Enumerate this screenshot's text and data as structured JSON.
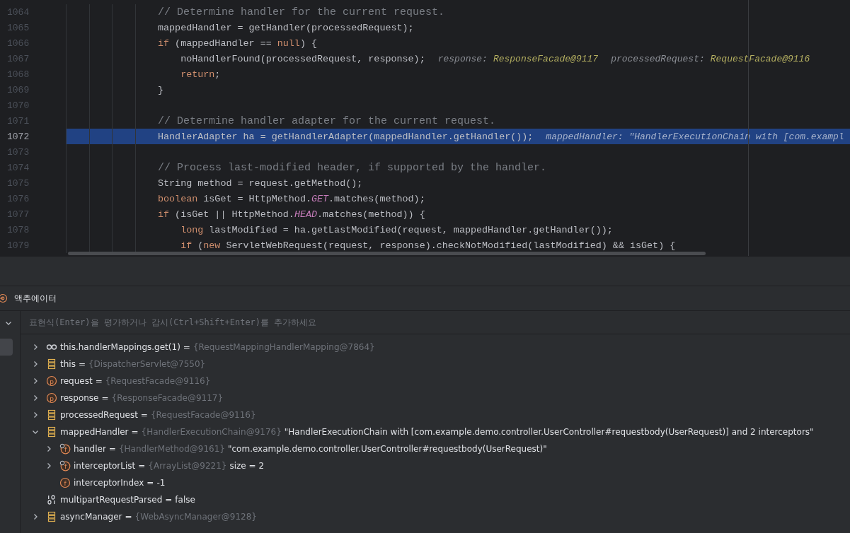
{
  "editor": {
    "lines": [
      {
        "number": "1064",
        "current": false,
        "segments": [
          {
            "kind": "comment",
            "text": "// Determine handler for the current request."
          }
        ]
      },
      {
        "number": "1065",
        "current": false,
        "segments": [
          {
            "kind": "plain",
            "text": "mappedHandler = getHandler(processedRequest);"
          }
        ]
      },
      {
        "number": "1066",
        "current": false,
        "segments": [
          {
            "kind": "keyword",
            "text": "if"
          },
          {
            "kind": "plain",
            "text": " (mappedHandler == "
          },
          {
            "kind": "keyword",
            "text": "null"
          },
          {
            "kind": "plain",
            "text": ") {"
          }
        ]
      },
      {
        "number": "1067",
        "current": false,
        "segments": [
          {
            "kind": "plain",
            "text": "    noHandlerFound(processedRequest, response);"
          },
          {
            "kind": "hint-label",
            "text": "response:"
          },
          {
            "kind": "hint-value",
            "text": "ResponseFacade@9117"
          },
          {
            "kind": "hint-label",
            "text": "processedRequest:"
          },
          {
            "kind": "hint-value",
            "text": "RequestFacade@9116"
          }
        ]
      },
      {
        "number": "1068",
        "current": false,
        "segments": [
          {
            "kind": "keyword",
            "text": "    return"
          },
          {
            "kind": "plain",
            "text": ";"
          }
        ]
      },
      {
        "number": "1069",
        "current": false,
        "segments": [
          {
            "kind": "plain",
            "text": "}"
          }
        ]
      },
      {
        "number": "1070",
        "current": false
      },
      {
        "number": "1071",
        "current": false,
        "segments": [
          {
            "kind": "comment",
            "text": "// Determine handler adapter for the current request."
          }
        ]
      },
      {
        "number": "1072",
        "current": true,
        "segments": [
          {
            "kind": "plain",
            "text": "HandlerAdapter ha = getHandlerAdapter(mappedHandler.getHandler());"
          },
          {
            "kind": "hint-label",
            "text": "mappedHandler: \"HandlerExecutionChain with [com.exampl"
          }
        ]
      },
      {
        "number": "1073",
        "current": false
      },
      {
        "number": "1074",
        "current": false,
        "segments": [
          {
            "kind": "comment",
            "text": "// Process last-modified header, if supported by the handler."
          }
        ]
      },
      {
        "number": "1075",
        "current": false,
        "segments": [
          {
            "kind": "plain",
            "text": "String method = request.getMethod();"
          }
        ]
      },
      {
        "number": "1076",
        "current": false,
        "segments": [
          {
            "kind": "keyword",
            "text": "boolean"
          },
          {
            "kind": "plain",
            "text": " isGet = HttpMethod."
          },
          {
            "kind": "static",
            "text": "GET"
          },
          {
            "kind": "plain",
            "text": ".matches(method);"
          }
        ]
      },
      {
        "number": "1077",
        "current": false,
        "segments": [
          {
            "kind": "keyword",
            "text": "if"
          },
          {
            "kind": "plain",
            "text": " (isGet || HttpMethod."
          },
          {
            "kind": "static",
            "text": "HEAD"
          },
          {
            "kind": "plain",
            "text": ".matches(method)) {"
          }
        ]
      },
      {
        "number": "1078",
        "current": false,
        "segments": [
          {
            "kind": "keyword",
            "text": "    long"
          },
          {
            "kind": "plain",
            "text": " lastModified = ha.getLastModified(request, mappedHandler.getHandler());"
          }
        ]
      },
      {
        "number": "1079",
        "current": false,
        "segments": [
          {
            "kind": "keyword",
            "text": "    if"
          },
          {
            "kind": "plain",
            "text": " ("
          },
          {
            "kind": "keyword",
            "text": "new"
          },
          {
            "kind": "plain",
            "text": " ServletWebRequest(request, response).checkNotModified(lastModified) && isGet) {"
          }
        ]
      }
    ]
  },
  "panel": {
    "title": "액추에이터",
    "expression_field": {
      "placeholder": "표현식(Enter)을 평가하거나 감시(Ctrl+Shift+Enter)를 추가하세요"
    },
    "variables": [
      {
        "kind": "watch",
        "name": "this.handlerMappings.get(1)",
        "equals": "=",
        "type": "{RequestMappingHandlerMapping@7864}",
        "expanded": false
      },
      {
        "kind": "object",
        "name": "this",
        "equals": "=",
        "type": "{DispatcherServlet@7550}",
        "expanded": false
      },
      {
        "kind": "parameter",
        "badge": "p",
        "name": "request",
        "equals": "=",
        "type": "{RequestFacade@9116}",
        "expanded": false
      },
      {
        "kind": "parameter",
        "badge": "p",
        "name": "response",
        "equals": "=",
        "type": "{ResponseFacade@9117}",
        "expanded": false
      },
      {
        "kind": "object",
        "name": "processedRequest",
        "equals": "=",
        "type": "{RequestFacade@9116}",
        "expanded": false
      },
      {
        "kind": "object",
        "name": "mappedHandler",
        "equals": "=",
        "type": "{HandlerExecutionChain@9176}",
        "value": "\"HandlerExecutionChain with [com.example.demo.controller.UserController#requestbody(UserRequest)] and 2 interceptors\"",
        "expanded": true,
        "children": [
          {
            "kind": "final-field",
            "badge": "f",
            "name": "handler",
            "equals": "=",
            "type": "{HandlerMethod@9161}",
            "value": "\"com.example.demo.controller.UserController#requestbody(UserRequest)\"",
            "expanded": false
          },
          {
            "kind": "final-field",
            "badge": "f",
            "name": "interceptorList",
            "equals": "=",
            "type": "{ArrayList@9221}",
            "value": "size = 2",
            "expanded": false
          },
          {
            "kind": "field",
            "badge": "f",
            "name": "interceptorIndex",
            "equals": "=",
            "value": "-1"
          }
        ]
      },
      {
        "kind": "primitive",
        "name": "multipartRequestParsed",
        "equals": "=",
        "value": "false"
      },
      {
        "kind": "object",
        "name": "asyncManager",
        "equals": "=",
        "type": "{WebAsyncManager@9128}",
        "expanded": false
      }
    ]
  }
}
